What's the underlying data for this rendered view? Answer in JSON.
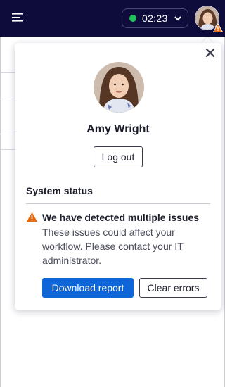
{
  "topbar": {
    "menu_icon": "hamburger-menu-icon",
    "timer": {
      "time": "02:23",
      "status_color": "#1fc15a",
      "chevron_icon": "chevron-down-icon"
    },
    "avatar_badge_icon": "warning-icon"
  },
  "colors": {
    "topbar_bg": "#0e0c3b",
    "primary": "#0f66d9",
    "warning": "#e8690e"
  },
  "profile": {
    "name": "Amy Wright",
    "logout_label": "Log out",
    "close_icon": "close-icon"
  },
  "system_status": {
    "heading": "System status",
    "alert": {
      "icon": "warning-icon",
      "title": "We have detected multiple issues",
      "body": "These issues could affect your workflow. Please contact your IT administrator."
    },
    "actions": {
      "download_label": "Download report",
      "clear_label": "Clear errors"
    }
  }
}
